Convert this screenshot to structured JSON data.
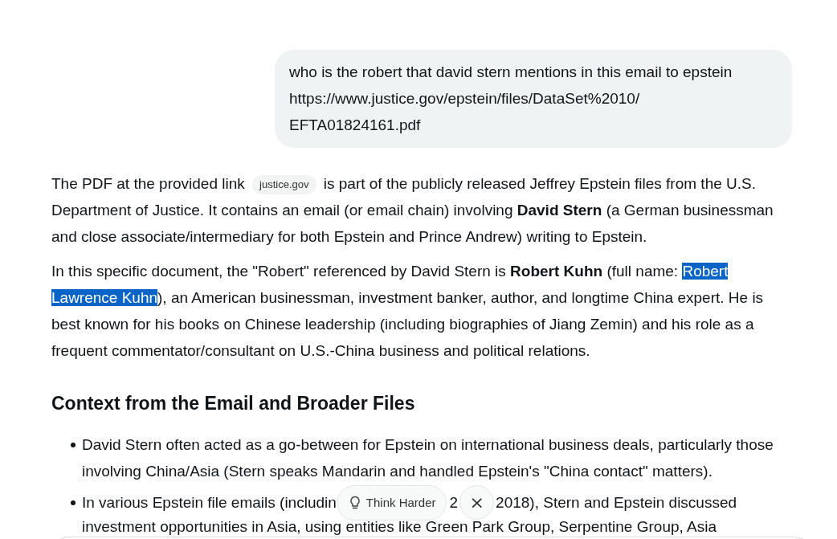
{
  "user_message": {
    "lines": [
      "who is the robert that david stern mentions in this email to epstein",
      "https://www.justice.gov/epstein/files/DataSet%2010/",
      "EFTA01824161.pdf"
    ]
  },
  "answer": {
    "paragraphs": [
      [
        {
          "kind": "text",
          "text": "The PDF at the provided link "
        },
        {
          "kind": "chip",
          "text": "justice.gov"
        },
        {
          "kind": "text",
          "text": " is part of the publicly released Jeffrey Epstein files from the U.S. Department of Justice. It contains an email (or email chain) involving "
        },
        {
          "kind": "text",
          "text": "David Stern",
          "bold": true
        },
        {
          "kind": "text",
          "text": " (a German businessman and close associate/intermediary for both Epstein and Prince Andrew) writing to Epstein."
        }
      ],
      [
        {
          "kind": "text",
          "text": "In this specific document, the \"Robert\" referenced by David Stern is "
        },
        {
          "kind": "text",
          "text": "Robert Kuhn",
          "bold": true
        },
        {
          "kind": "text",
          "text": " (full name: "
        },
        {
          "kind": "text",
          "text": "Robert Lawrence Kuhn",
          "selected": true
        },
        {
          "kind": "text",
          "text": "), an American businessman, investment banker, author, and longtime China expert. He is best known for his books on Chinese leadership (including biographies of Jiang Zemin) and his role as a frequent commentator/consultant on U.S.-China business and political relations."
        }
      ]
    ],
    "heading": "Context from the Email and Broader Files",
    "bullets": [
      {
        "kind": "plain",
        "text": "David Stern often acted as a go-between for Epstein on international business deals, particularly those involving China/Asia (Stern speaks Mandarin and handled Epstein's \"China contact\" matters)."
      },
      {
        "kind": "covered",
        "parts": [
          "In various Epstein file emails (includin",
          "2",
          "2018), Stern and Epstein discussed"
        ],
        "continuation": "investment opportunities in Asia, using entities like Green Park Group, Serpentine Group, Asia"
      }
    ]
  },
  "floating_actions": {
    "think_harder": "Think Harder",
    "close": "×"
  }
}
